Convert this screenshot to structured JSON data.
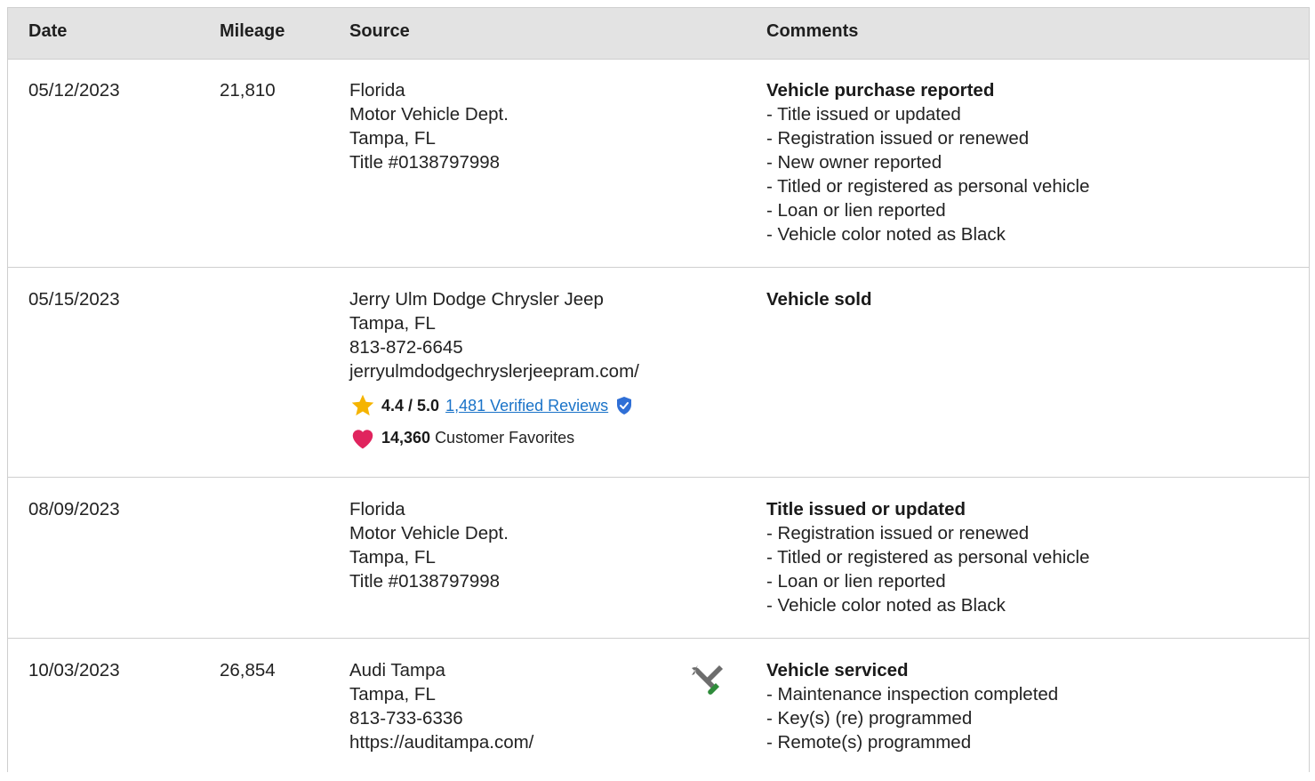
{
  "header": {
    "date": "Date",
    "mileage": "Mileage",
    "source": "Source",
    "comments": "Comments"
  },
  "rows": [
    {
      "date": "05/12/2023",
      "mileage": "21,810",
      "source": [
        "Florida",
        "Motor Vehicle Dept.",
        "Tampa, FL",
        "Title #0138797998"
      ],
      "comment_title": "Vehicle purchase reported",
      "comment_items": [
        "- Title issued or updated",
        "- Registration issued or renewed",
        "- New owner reported",
        "- Titled or registered as personal vehicle",
        "- Loan or lien reported",
        "- Vehicle color noted as Black"
      ]
    },
    {
      "date": "05/15/2023",
      "mileage": "",
      "source": [
        "Jerry Ulm Dodge Chrysler Jeep",
        "Tampa, FL",
        "813-872-6645",
        "jerryulmdodgechryslerjeepram.com/"
      ],
      "rating": {
        "score": "4.4 / 5.0",
        "reviews_link": "1,481 Verified Reviews",
        "favorites_count": "14,360",
        "favorites_label": "Customer Favorites"
      },
      "comment_title": "Vehicle sold",
      "comment_items": []
    },
    {
      "date": "08/09/2023",
      "mileage": "",
      "source": [
        "Florida",
        "Motor Vehicle Dept.",
        "Tampa, FL",
        "Title #0138797998"
      ],
      "comment_title": "Title issued or updated",
      "comment_items": [
        "- Registration issued or renewed",
        "- Titled or registered as personal vehicle",
        "- Loan or lien reported",
        "- Vehicle color noted as Black"
      ]
    },
    {
      "date": "10/03/2023",
      "mileage": "26,854",
      "source": [
        "Audi Tampa",
        "Tampa, FL",
        "813-733-6336",
        "https://auditampa.com/"
      ],
      "icon": "service-tools-icon",
      "comment_title": "Vehicle serviced",
      "comment_items": [
        "- Maintenance inspection completed",
        "- Key(s) (re) programmed",
        "- Remote(s) programmed"
      ]
    }
  ],
  "colors": {
    "header_bg": "#e3e3e3",
    "link": "#1a73c8",
    "star": "#f5b400",
    "heart": "#e0245e",
    "verified_badge": "#2f6fd6",
    "tool_green": "#2e8b3a",
    "tool_gray": "#6d6d6d"
  }
}
